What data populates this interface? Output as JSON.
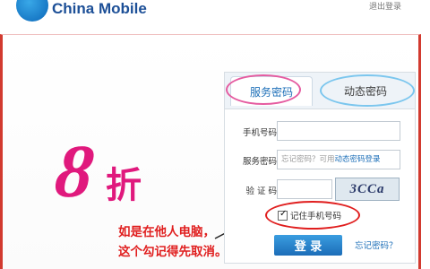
{
  "brand": {
    "logo_text": "China Mobile",
    "top_right": "退出登录"
  },
  "promo": {
    "number": "8",
    "text": "折"
  },
  "annotation": {
    "line1": "如是在他人电脑，",
    "line2": "这个勾记得先取消。"
  },
  "login": {
    "tabs": [
      {
        "label": "服务密码"
      },
      {
        "label": "动态密码"
      }
    ],
    "phone_label": "手机号码",
    "password_label": "服务密码",
    "password_hint": "忘记密码？可用",
    "password_hint_link": "动态密码登录",
    "captcha_label": "验 证 码",
    "captcha_text": "3CCa",
    "remember_label": "记住手机号码",
    "login_button": "登 录",
    "forgot_link": "忘记密码？"
  },
  "colors": {
    "brand_blue": "#1c4f97",
    "promo_pink": "#e0197d",
    "annotation_red": "#e01e1e"
  }
}
